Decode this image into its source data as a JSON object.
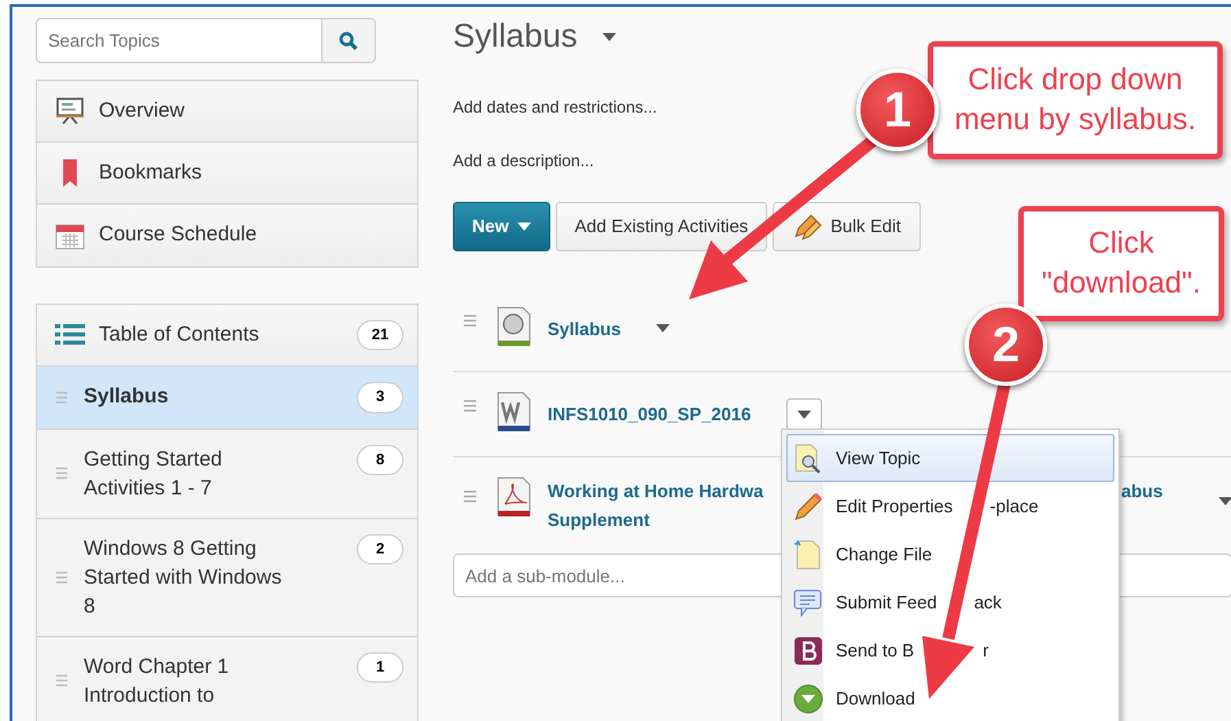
{
  "sidebar": {
    "search": {
      "placeholder": "Search Topics"
    },
    "nav_items": [
      {
        "label": "Overview",
        "kind": "overview"
      },
      {
        "label": "Bookmarks",
        "kind": "bookmarks"
      },
      {
        "label": "Course Schedule",
        "kind": "schedule"
      }
    ],
    "toc": {
      "label": "Table of Contents",
      "count": "21"
    },
    "modules": [
      {
        "label": "Syllabus",
        "count": "3",
        "selected": true
      },
      {
        "label": "Getting Started Activities 1 - 7",
        "count": "8",
        "selected": false
      },
      {
        "label": "Windows 8 Getting Started with Windows 8",
        "count": "2",
        "selected": false
      },
      {
        "label": "Word Chapter 1 Introduction to",
        "count": "1",
        "selected": false
      }
    ]
  },
  "main": {
    "title": "Syllabus",
    "links": [
      "Add dates and restrictions...",
      "Add a description..."
    ],
    "buttons": [
      {
        "label": "New",
        "kind": "primary"
      },
      {
        "label": "Add Existing Activities",
        "kind": "plain"
      },
      {
        "label": "Bulk Edit",
        "kind": "edit"
      }
    ],
    "topics": [
      {
        "kind": "web",
        "parts": [
          "Syllabus"
        ]
      },
      {
        "kind": "word",
        "parts": [
          "INFS1010_090_SP_2016"
        ]
      },
      {
        "kind": "pdf",
        "parts": [
          "Working at Home Hardwa",
          "abus",
          "Supplement"
        ]
      }
    ],
    "submodule": {
      "placeholder": "Add a sub-module..."
    }
  },
  "menu": [
    {
      "parts": [
        "View Topic"
      ],
      "kind": "view",
      "selected": true
    },
    {
      "parts": [
        "Edit Properties",
        "-place"
      ],
      "kind": "edit",
      "selected": false
    },
    {
      "parts": [
        "Change File"
      ],
      "kind": "file",
      "selected": false
    },
    {
      "parts": [
        "Submit Feed",
        "ack"
      ],
      "kind": "feedback",
      "selected": false
    },
    {
      "parts": [
        "Send to B",
        "r"
      ],
      "kind": "binder",
      "selected": false
    },
    {
      "parts": [
        "Download"
      ],
      "kind": "download",
      "selected": false
    }
  ],
  "callouts": [
    {
      "number": "1",
      "text": "Click drop down menu by syllabus."
    },
    {
      "number": "2",
      "text": "Click \"download\"."
    }
  ]
}
